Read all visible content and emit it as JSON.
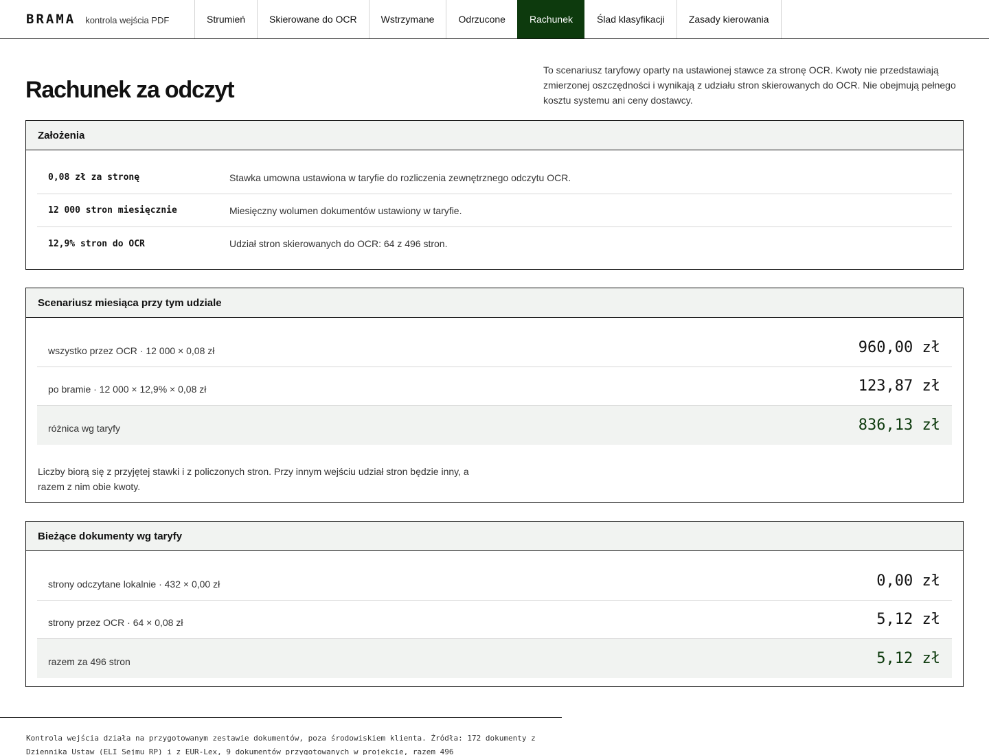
{
  "brand": {
    "logo": "BRAMA",
    "subtitle": "kontrola wejścia PDF"
  },
  "nav": {
    "tabs": [
      {
        "label": "Strumień"
      },
      {
        "label": "Skierowane do OCR"
      },
      {
        "label": "Wstrzymane"
      },
      {
        "label": "Odrzucone"
      },
      {
        "label": "Rachunek",
        "active": true
      },
      {
        "label": "Ślad klasyfikacji"
      },
      {
        "label": "Zasady kierowania"
      }
    ]
  },
  "header": {
    "title": "Rachunek za odczyt",
    "intro": "To scenariusz taryfowy oparty na ustawionej stawce za stronę OCR. Kwoty nie przedstawiają zmierzonej oszczędności i wynikają z udziału stron skierowanych do OCR. Nie obejmują pełnego kosztu systemu ani ceny dostawcy."
  },
  "assumptions": {
    "title": "Założenia",
    "rows": [
      {
        "key": "0,08 zł za stronę",
        "desc": "Stawka umowna ustawiona w taryfie do rozliczenia zewnętrznego odczytu OCR."
      },
      {
        "key": "12 000 stron miesięcznie",
        "desc": "Miesięczny wolumen dokumentów ustawiony w taryfie."
      },
      {
        "key": "12,9% stron do OCR",
        "desc": "Udział stron skierowanych do OCR: 64 z 496 stron."
      }
    ]
  },
  "scenario": {
    "title": "Scenariusz miesiąca przy tym udziale",
    "rows": [
      {
        "label": "wszystko przez OCR · 12 000 × 0,08 zł",
        "value": "960,00 zł"
      },
      {
        "label": "po bramie · 12 000 × 12,9% × 0,08 zł",
        "value": "123,87 zł"
      },
      {
        "label": "różnica wg taryfy",
        "value": "836,13 zł"
      }
    ],
    "note": "Liczby biorą się z przyjętej stawki i z policzonych stron. Przy innym wejściu udział stron będzie inny, a razem z nim obie kwoty."
  },
  "current": {
    "title": "Bieżące dokumenty wg taryfy",
    "rows": [
      {
        "label": "strony odczytane lokalnie · 432 × 0,00 zł",
        "value": "0,00 zł"
      },
      {
        "label": "strony przez OCR · 64 × 0,08 zł",
        "value": "5,12 zł"
      },
      {
        "label": "razem za 496 stron",
        "value": "5,12 zł"
      }
    ]
  },
  "footer": {
    "text": "Kontrola wejścia działa na przygotowanym zestawie dokumentów, poza środowiskiem klienta. Źródła: 172 dokumenty z Dziennika Ustaw (ELI Sejmu RP) i z EUR-Lex, 9 dokumentów przygotowanych w projekcie, razem 496"
  },
  "colors": {
    "accent": "#0d3a0d",
    "panel": "#f1f3f1",
    "border": "#111111"
  }
}
